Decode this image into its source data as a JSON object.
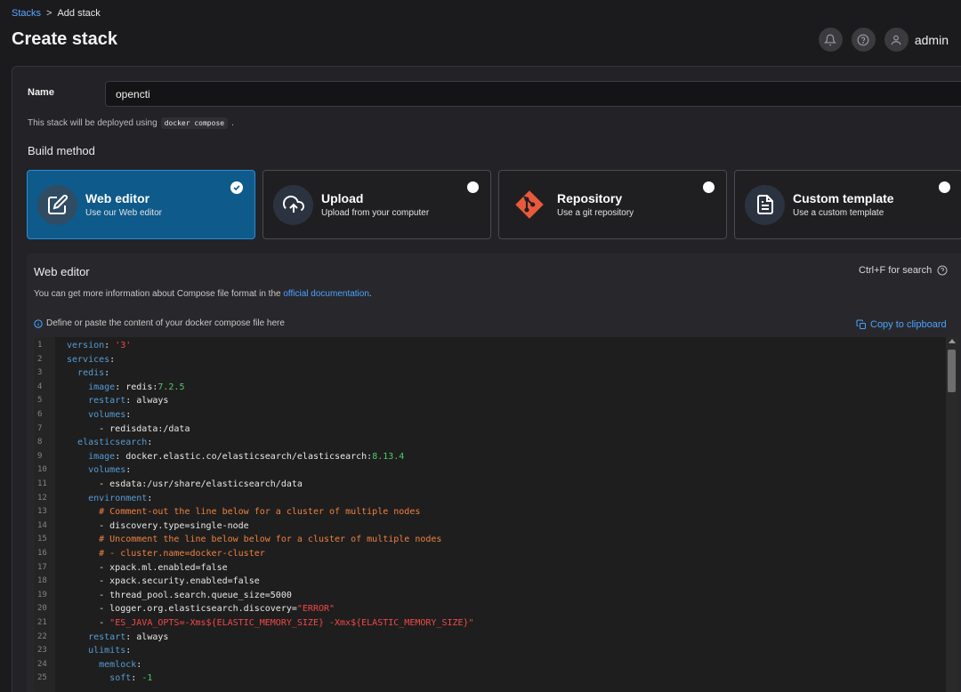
{
  "breadcrumb": {
    "root": "Stacks",
    "sep": ">",
    "current": "Add stack"
  },
  "page": {
    "title": "Create stack"
  },
  "user": {
    "name": "admin"
  },
  "form": {
    "name_label": "Name",
    "name_value": "opencti",
    "deploy_prefix": "This stack will be deployed using",
    "deploy_tool": "docker compose",
    "deploy_suffix": "."
  },
  "build": {
    "title": "Build method",
    "methods": [
      {
        "title": "Web editor",
        "sub": "Use our Web editor",
        "icon": "edit-icon",
        "selected": true
      },
      {
        "title": "Upload",
        "sub": "Upload from your computer",
        "icon": "cloud-upload-icon",
        "selected": false
      },
      {
        "title": "Repository",
        "sub": "Use a git repository",
        "icon": "git-icon",
        "selected": false
      },
      {
        "title": "Custom template",
        "sub": "Use a custom template",
        "icon": "file-text-icon",
        "selected": false
      }
    ]
  },
  "editor": {
    "title": "Web editor",
    "search_hint": "Ctrl+F for search",
    "info_prefix": "You can get more information about Compose file format in the",
    "info_link": "official documentation",
    "info_suffix": ".",
    "define_hint": "Define or paste the content of your docker compose file here",
    "copy_label": "Copy to clipboard",
    "colors": {
      "key": "#569cd6",
      "string": "#f44747",
      "number": "#4ec970",
      "comment": "#f08040",
      "link": "#4aa3ff",
      "selected": "#0e5a8a"
    },
    "lines": [
      [
        [
          "key",
          "version"
        ],
        [
          "txt",
          ": "
        ],
        [
          "str",
          "'3'"
        ]
      ],
      [
        [
          "key",
          "services"
        ],
        [
          "txt",
          ":"
        ]
      ],
      [
        [
          "txt",
          "  "
        ],
        [
          "key",
          "redis"
        ],
        [
          "txt",
          ":"
        ]
      ],
      [
        [
          "txt",
          "    "
        ],
        [
          "key",
          "image"
        ],
        [
          "txt",
          ": redis:"
        ],
        [
          "num",
          "7.2.5"
        ]
      ],
      [
        [
          "txt",
          "    "
        ],
        [
          "key",
          "restart"
        ],
        [
          "txt",
          ": always"
        ]
      ],
      [
        [
          "txt",
          "    "
        ],
        [
          "key",
          "volumes"
        ],
        [
          "txt",
          ":"
        ]
      ],
      [
        [
          "txt",
          "      - redisdata:/data"
        ]
      ],
      [
        [
          "txt",
          "  "
        ],
        [
          "key",
          "elasticsearch"
        ],
        [
          "txt",
          ":"
        ]
      ],
      [
        [
          "txt",
          "    "
        ],
        [
          "key",
          "image"
        ],
        [
          "txt",
          ": docker.elastic.co/elasticsearch/elasticsearch:"
        ],
        [
          "num",
          "8.13.4"
        ]
      ],
      [
        [
          "txt",
          "    "
        ],
        [
          "key",
          "volumes"
        ],
        [
          "txt",
          ":"
        ]
      ],
      [
        [
          "txt",
          "      - esdata:/usr/share/elasticsearch/data"
        ]
      ],
      [
        [
          "txt",
          "    "
        ],
        [
          "key",
          "environment"
        ],
        [
          "txt",
          ":"
        ]
      ],
      [
        [
          "txt",
          "      "
        ],
        [
          "cmt",
          "# Comment-out the line below for a cluster of multiple nodes"
        ]
      ],
      [
        [
          "txt",
          "      - discovery.type=single-node"
        ]
      ],
      [
        [
          "txt",
          "      "
        ],
        [
          "cmt",
          "# Uncomment the line below below for a cluster of multiple nodes"
        ]
      ],
      [
        [
          "txt",
          "      "
        ],
        [
          "cmt",
          "# - cluster.name=docker-cluster"
        ]
      ],
      [
        [
          "txt",
          "      - xpack.ml.enabled=false"
        ]
      ],
      [
        [
          "txt",
          "      - xpack.security.enabled=false"
        ]
      ],
      [
        [
          "txt",
          "      - thread_pool.search.queue_size=5000"
        ]
      ],
      [
        [
          "txt",
          "      - logger.org.elasticsearch.discovery="
        ],
        [
          "str",
          "\"ERROR\""
        ]
      ],
      [
        [
          "txt",
          "      - "
        ],
        [
          "str",
          "\"ES_JAVA_OPTS=-Xms${ELASTIC_MEMORY_SIZE} -Xmx${ELASTIC_MEMORY_SIZE}\""
        ]
      ],
      [
        [
          "txt",
          "    "
        ],
        [
          "key",
          "restart"
        ],
        [
          "txt",
          ": always"
        ]
      ],
      [
        [
          "txt",
          "    "
        ],
        [
          "key",
          "ulimits"
        ],
        [
          "txt",
          ":"
        ]
      ],
      [
        [
          "txt",
          "      "
        ],
        [
          "key",
          "memlock"
        ],
        [
          "txt",
          ":"
        ]
      ],
      [
        [
          "txt",
          "        "
        ],
        [
          "key",
          "soft"
        ],
        [
          "txt",
          ": "
        ],
        [
          "num",
          "-1"
        ]
      ]
    ]
  }
}
